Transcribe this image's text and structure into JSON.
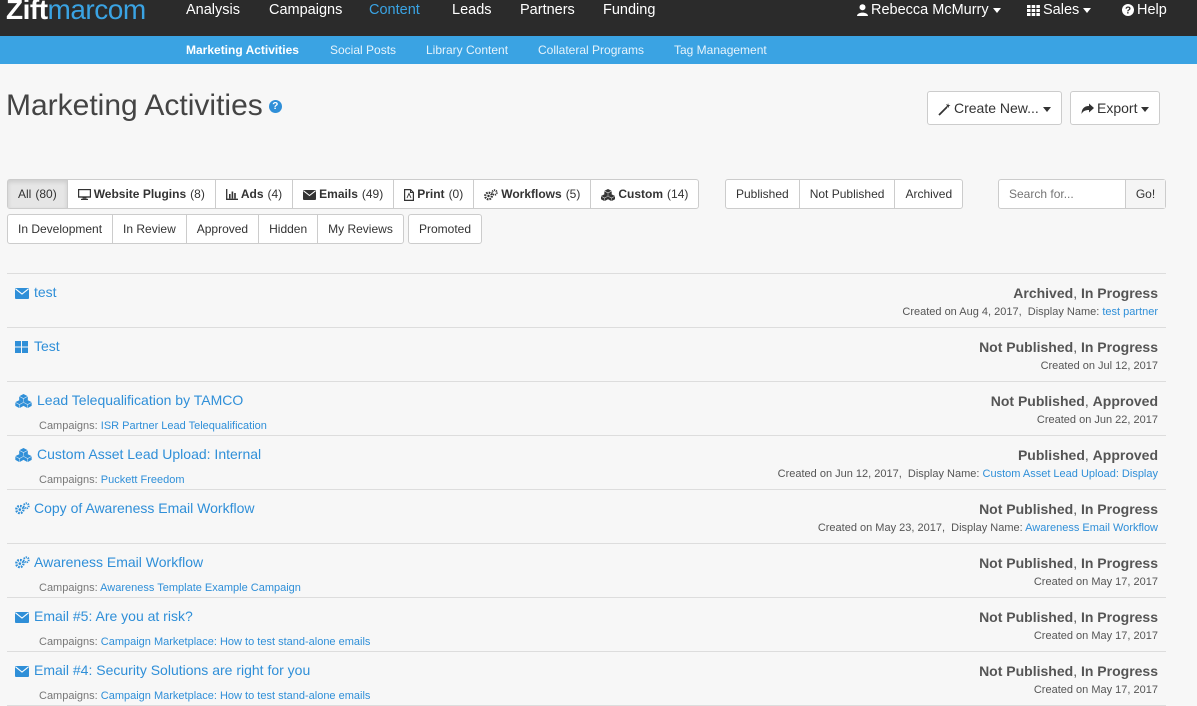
{
  "brand": {
    "logo_a": "Zift",
    "logo_b": "marcom"
  },
  "topnav": {
    "items": [
      "Analysis",
      "Campaigns",
      "Content",
      "Leads",
      "Partners",
      "Funding"
    ],
    "active": "Content",
    "user": "Rebecca McMurry",
    "sales": "Sales",
    "help": "Help"
  },
  "subnav": {
    "items": [
      "Marketing Activities",
      "Social Posts",
      "Library Content",
      "Collateral Programs",
      "Tag Management"
    ],
    "active": "Marketing Activities"
  },
  "header": {
    "title": "Marketing Activities",
    "help_symbol": "?",
    "create_new": "Create New...",
    "export": "Export"
  },
  "filters": {
    "types": [
      {
        "label": "All",
        "count": "(80)"
      },
      {
        "label": "Website Plugins",
        "count": "(8)"
      },
      {
        "label": "Ads",
        "count": "(4)"
      },
      {
        "label": "Emails",
        "count": "(49)"
      },
      {
        "label": "Print",
        "count": "(0)"
      },
      {
        "label": "Workflows",
        "count": "(5)"
      },
      {
        "label": "Custom",
        "count": "(14)"
      }
    ],
    "publish": [
      "Published",
      "Not Published",
      "Archived"
    ],
    "review": [
      "In Development",
      "In Review",
      "Approved",
      "Hidden",
      "My Reviews"
    ],
    "promoted": "Promoted",
    "search_placeholder": "Search for...",
    "go": "Go!"
  },
  "activities": [
    {
      "icon": "envelope-icon",
      "title": "test",
      "status_a": "Archived",
      "status_b": "In Progress",
      "created": "Created on Aug 4, 2017,",
      "display_label": "Display Name:",
      "display_name": "test partner"
    },
    {
      "icon": "grid-icon",
      "title": "Test",
      "status_a": "Not Published",
      "status_b": "In Progress",
      "created": "Created on Jul 12, 2017"
    },
    {
      "icon": "cubes-icon",
      "title": "Lead Telequalification by TAMCO",
      "status_a": "Not Published",
      "status_b": "Approved",
      "created": "Created on Jun 22, 2017",
      "campaign_label": "Campaigns:",
      "campaign": "ISR Partner Lead Telequalification"
    },
    {
      "icon": "cubes-icon",
      "title": "Custom Asset Lead Upload: Internal",
      "status_a": "Published",
      "status_b": "Approved",
      "created": "Created on Jun 12, 2017,",
      "display_label": "Display Name:",
      "display_name": "Custom Asset Lead Upload: Display",
      "campaign_label": "Campaigns:",
      "campaign": "Puckett Freedom"
    },
    {
      "icon": "cogs-icon",
      "title": "Copy of Awareness Email Workflow",
      "status_a": "Not Published",
      "status_b": "In Progress",
      "created": "Created on May 23, 2017,",
      "display_label": "Display Name:",
      "display_name": "Awareness Email Workflow"
    },
    {
      "icon": "cogs-icon",
      "title": "Awareness Email Workflow",
      "status_a": "Not Published",
      "status_b": "In Progress",
      "created": "Created on May 17, 2017",
      "campaign_label": "Campaigns:",
      "campaign": "Awareness Template Example Campaign"
    },
    {
      "icon": "envelope-icon",
      "title": "Email #5: Are you at risk?",
      "status_a": "Not Published",
      "status_b": "In Progress",
      "created": "Created on May 17, 2017",
      "campaign_label": "Campaigns:",
      "campaign": "Campaign Marketplace: How to test stand-alone emails"
    },
    {
      "icon": "envelope-icon",
      "title": "Email #4: Security Solutions are right for you",
      "status_a": "Not Published",
      "status_b": "In Progress",
      "created": "Created on May 17, 2017",
      "campaign_label": "Campaigns:",
      "campaign": "Campaign Marketplace: How to test stand-alone emails"
    }
  ],
  "colors": {
    "topbar": "#2b2b2b",
    "accent": "#3aa3e3",
    "link": "#2f8fd8"
  }
}
